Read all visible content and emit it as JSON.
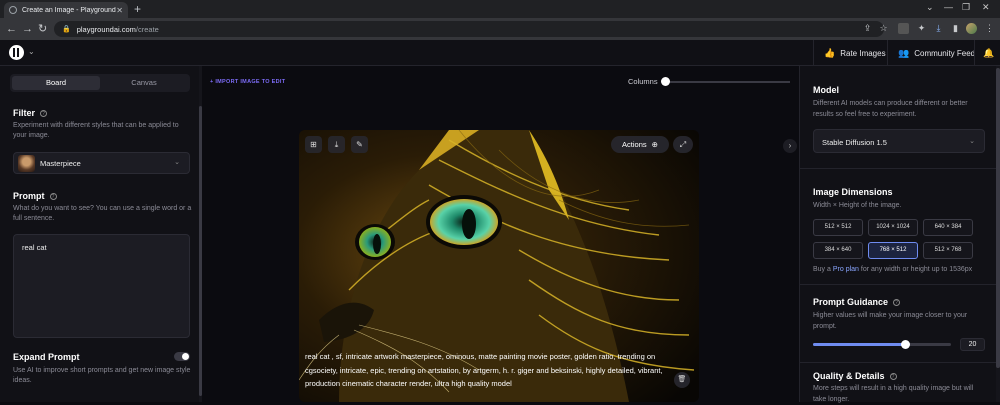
{
  "browser": {
    "tab_title": "Create an Image - Playground",
    "url_host": "playgroundai.com",
    "url_path": "/create"
  },
  "header": {
    "rate_images": "Rate Images",
    "community_feed": "Community Feed"
  },
  "left": {
    "tabs": [
      "Board",
      "Canvas"
    ],
    "active_tab": "Board",
    "filter_title": "Filter",
    "filter_desc": "Experiment with different styles that can be applied to your image.",
    "filter_value": "Masterpiece",
    "prompt_title": "Prompt",
    "prompt_desc": "What do you want to see? You can use a single word or a full sentence.",
    "prompt_value": "real cat",
    "expand_title": "Expand Prompt",
    "expand_desc": "Use AI to improve short prompts and get new image style ideas.",
    "expand_enabled": true
  },
  "center": {
    "import_label": "+ IMPORT IMAGE TO EDIT",
    "columns_label": "Columns",
    "actions_label": "Actions",
    "caption": "real cat , sf, intricate artwork masterpiece, ominous, matte painting movie poster, golden ratio, trending on cgsociety, intricate, epic, trending on artstation, by artgerm, h. r. giger and beksinski, highly detailed, vibrant, production cinematic character render, ultra high quality model"
  },
  "right": {
    "model_title": "Model",
    "model_desc": "Different AI models can produce different or better results so feel free to experiment.",
    "model_value": "Stable Diffusion 1.5",
    "dims_title": "Image Dimensions",
    "dims_desc": "Width × Height of the image.",
    "dims": [
      "512 × 512",
      "1024 × 1024",
      "640 × 384",
      "384 × 640",
      "768 × 512",
      "512 × 768"
    ],
    "dims_selected": "768 × 512",
    "pro_prefix": "Buy a ",
    "pro_link": "Pro plan",
    "pro_suffix": " for any width or height up to 1536px",
    "guidance_title": "Prompt Guidance",
    "guidance_desc": "Higher values will make your image closer to your prompt.",
    "guidance_value": "20",
    "guidance_fraction": 0.67,
    "quality_title": "Quality & Details",
    "quality_desc": "More steps will result in a high quality image but will take longer."
  },
  "colors": {
    "accent": "#6f8cf0",
    "import_link": "#7c6cf6",
    "background": "#0b0b10"
  }
}
